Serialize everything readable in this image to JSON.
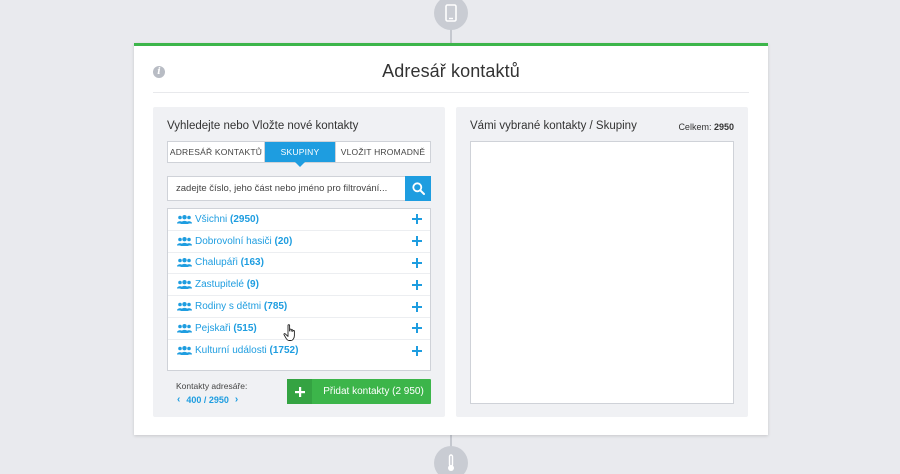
{
  "header": {
    "title": "Adresář kontaktů",
    "info_icon": "info-icon"
  },
  "left_panel": {
    "heading": "Vyhledejte nebo Vložte nové kontakty",
    "tabs": [
      {
        "label": "Adresář kontaktů",
        "active": false
      },
      {
        "label": "Skupiny",
        "active": true
      },
      {
        "label": "Vložit hromadně",
        "active": false
      }
    ],
    "search": {
      "placeholder": "zadejte číslo, jeho část nebo jméno pro filtrování...",
      "value": ""
    },
    "groups": [
      {
        "name": "Všichni",
        "count": "(2950)"
      },
      {
        "name": "Dobrovolní hasiči",
        "count": "(20)"
      },
      {
        "name": "Chalupáři",
        "count": "(163)"
      },
      {
        "name": "Zastupitelé",
        "count": "(9)"
      },
      {
        "name": "Rodiny s dětmi",
        "count": "(785)"
      },
      {
        "name": "Pejskaři",
        "count": "(515)"
      },
      {
        "name": "Kulturní události",
        "count": "(1752)"
      }
    ],
    "pager": {
      "label": "Kontakty adresáře:",
      "pages": "400 / 2950"
    },
    "add_button_label": "Přidat kontakty (2 950)"
  },
  "right_panel": {
    "heading": "Vámi vybrané kontakty / Skupiny",
    "total_label": "Celkem:",
    "total_value": "2950"
  },
  "colors": {
    "accent_blue": "#1e9de0",
    "accent_green": "#3cb54a",
    "background": "#e9eaee"
  }
}
